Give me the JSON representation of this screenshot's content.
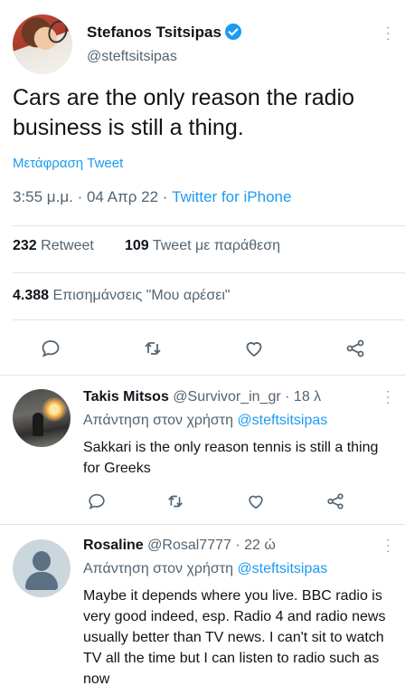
{
  "tweet": {
    "author_name": "Stefanos Tsitsipas",
    "author_handle": "@steftsitsipas",
    "text": "Cars are the only reason the radio business is still a thing.",
    "translate_label": "Μετάφραση Tweet",
    "time": "3:55 μ.μ.",
    "date": "04 Απρ 22",
    "source": "Twitter for iPhone",
    "retweets_count": "232",
    "retweets_label": "Retweet",
    "quotes_count": "109",
    "quotes_label": "Tweet με παράθεση",
    "likes_count": "4.388",
    "likes_label": "Επισημάνσεις \"Μου αρέσει\""
  },
  "replies": [
    {
      "name": "Takis Mitsos",
      "handle": "@Survivor_in_gr",
      "age": "18 λ",
      "replying_prefix": "Απάντηση στον χρήστη",
      "replying_to": "@steftsitsipas",
      "text": "Sakkari is the only reason tennis is still a thing for Greeks"
    },
    {
      "name": "Rosaline",
      "handle": "@Rosal7777",
      "age": "22 ώ",
      "replying_prefix": "Απάντηση στον χρήστη",
      "replying_to": "@steftsitsipas",
      "text": "Maybe it depends where you live. BBC radio is very good indeed, esp. Radio 4 and radio news usually better than TV news. I can't sit to watch TV all the time but I can listen to radio such as now"
    }
  ],
  "colors": {
    "accent": "#1d9bf0",
    "secondary_text": "#536471",
    "primary_text": "#0f1419"
  },
  "icons": {
    "reply": "reply-icon",
    "retweet": "retweet-icon",
    "like": "like-icon",
    "share": "share-icon",
    "more": "more-icon",
    "verified": "verified-badge-icon"
  }
}
